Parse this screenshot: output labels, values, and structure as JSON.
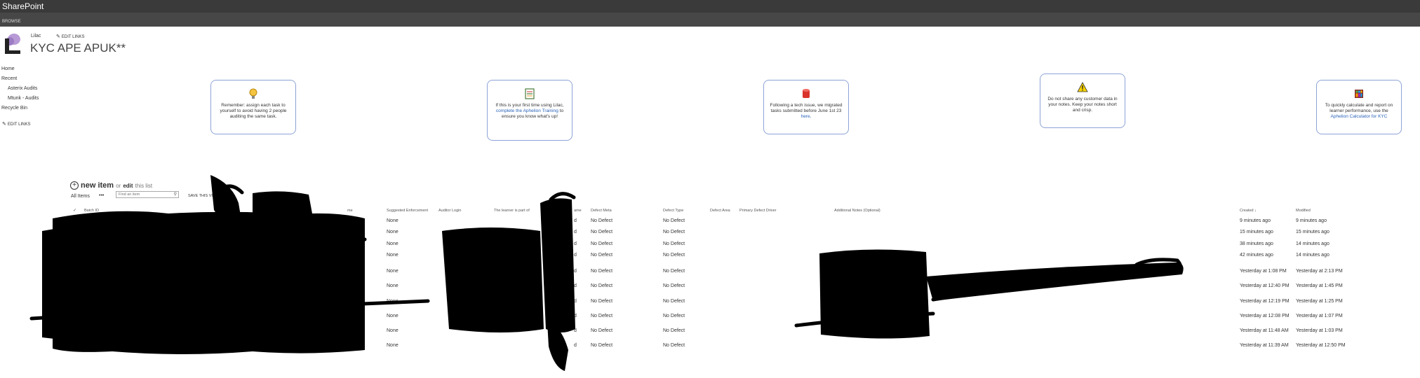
{
  "suitebar": {
    "brand": "SharePoint"
  },
  "ribbon": {
    "browse": "BROWSE"
  },
  "site": {
    "name": "Lilac",
    "edit_links": "EDIT LINKS",
    "title": "KYC APE APUK**"
  },
  "quicklaunch": {
    "items": [
      "Home",
      "Recent",
      "Asterix Audits",
      "Mtunk - Audits",
      "Recycle Bin"
    ],
    "edit_links": "EDIT LINKS"
  },
  "tiles": [
    {
      "icon": "lightbulb-icon",
      "text": "Remember: assign each task to yourself to avoid having 2 people auditing the same task."
    },
    {
      "icon": "notebook-icon",
      "text_pre": "If this is your first time using Lilac, ",
      "link": "complete the Aphelion Training",
      "text_post": " to ensure you know what's up!"
    },
    {
      "icon": "database-icon",
      "text_pre": "Following a tech issue, we migrated tasks submitted before June 1st 23 ",
      "link": "here",
      "text_post": "."
    },
    {
      "icon": "warning-icon",
      "text": "Do not share any customer data in your notes. Keep your notes short and crisp."
    },
    {
      "icon": "calculator-icon",
      "text_pre": "To quickly calculate and report on learner performance, use the ",
      "link": "Aphelion Calculator for KYC",
      "text_post": ""
    }
  ],
  "list": {
    "new_item": "new item",
    "or": "or",
    "edit": "edit",
    "this_list": "this list",
    "view": "All Items",
    "search_placeholder": "Find an item",
    "save_view": "SAVE THIS VIEW",
    "columns": {
      "batch_id": "Batch ID",
      "name": "me",
      "suggested_enforcement": "Suggested Enforcement",
      "auditor_login": "Auditor Login",
      "learner_part": "The learner is part of",
      "name2": "ame",
      "defect_meta": "Defect Meta",
      "defect_type": "Defect Type",
      "defect_area": "Defect Area",
      "primary_defect_driver": "Primary Defect Driver",
      "additional_notes": "Additional Notes (Optional)",
      "created": "Created ↓",
      "modified": "Modified"
    },
    "rows": [
      {
        "enforcement": "None",
        "meta": "No Defect",
        "type": "No Defect",
        "created": "9 minutes ago",
        "modified": "9 minutes ago"
      },
      {
        "enforcement": "None",
        "meta": "No Defect",
        "type": "No Defect",
        "created": "15 minutes ago",
        "modified": "15 minutes ago"
      },
      {
        "enforcement": "None",
        "meta": "No Defect",
        "type": "No Defect",
        "created": "38 minutes ago",
        "modified": "14 minutes ago"
      },
      {
        "enforcement": "None",
        "meta": "No Defect",
        "type": "No Defect",
        "created": "42 minutes ago",
        "modified": "14 minutes ago"
      },
      {
        "enforcement": "None",
        "meta": "No Defect",
        "type": "No Defect",
        "created": "Yesterday at 1:08 PM",
        "modified": "Yesterday at 2:13 PM"
      },
      {
        "enforcement": "None",
        "meta": "No Defect",
        "type": "No Defect",
        "created": "Yesterday at 12:40 PM",
        "modified": "Yesterday at 1:45 PM"
      },
      {
        "enforcement": "None",
        "meta": "No Defect",
        "type": "No Defect",
        "created": "Yesterday at 12:19 PM",
        "modified": "Yesterday at 1:25 PM"
      },
      {
        "enforcement": "None",
        "meta": "No Defect",
        "type": "No Defect",
        "created": "Yesterday at 12:08 PM",
        "modified": "Yesterday at 1:07 PM"
      },
      {
        "enforcement": "None",
        "meta": "No Defect",
        "type": "No Defect",
        "created": "Yesterday at 11:48 AM",
        "modified": "Yesterday at 1:03 PM"
      },
      {
        "enforcement": "None",
        "meta": "No Defect",
        "type": "No Defect",
        "created": "Yesterday at 11:39 AM",
        "modified": "Yesterday at 12:50 PM"
      }
    ],
    "row_suffix": "d"
  }
}
